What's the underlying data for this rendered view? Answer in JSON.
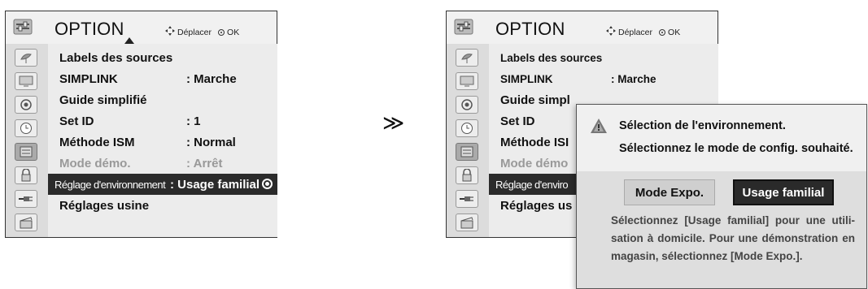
{
  "separator": "≫",
  "menu_left": {
    "title": "OPTION",
    "nav_move": "Déplacer",
    "nav_ok": "OK",
    "rows": [
      {
        "label": "Labels des sources",
        "value": ""
      },
      {
        "label": "SIMPLINK",
        "value": ": Marche"
      },
      {
        "label": "Guide simplifié",
        "value": ""
      },
      {
        "label": "Set ID",
        "value": ": 1"
      },
      {
        "label": "Méthode ISM",
        "value": ": Normal"
      },
      {
        "label": "Mode démo.",
        "value": ": Arrêt"
      },
      {
        "label": "Réglage d'environnement",
        "value": ": Usage familial"
      },
      {
        "label": "Réglages usine",
        "value": ""
      }
    ]
  },
  "menu_right": {
    "title": "OPTION",
    "nav_move": "Déplacer",
    "nav_ok": "OK",
    "rows": [
      {
        "label": "Labels des sources",
        "value": ""
      },
      {
        "label": "SIMPLINK",
        "value": ": Marche"
      },
      {
        "label": "Guide simpl",
        "value": ""
      },
      {
        "label": "Set ID",
        "value": ""
      },
      {
        "label": "Méthode ISI",
        "value": ""
      },
      {
        "label": "Mode démo",
        "value": ""
      },
      {
        "label": "Réglage d'enviro",
        "value": ""
      },
      {
        "label": "Réglages us",
        "value": ""
      }
    ]
  },
  "popup": {
    "line1": "Sélection de l'environnement.",
    "line2": "Sélectionnez le mode de config. souhaité.",
    "btn_expo": "Mode Expo.",
    "btn_home": "Usage familial",
    "info": "Sélectionnez [Usage familial] pour une utili- sation à domicile. Pour une démonstration en magasin, sélectionnez [Mode Expo.]."
  }
}
